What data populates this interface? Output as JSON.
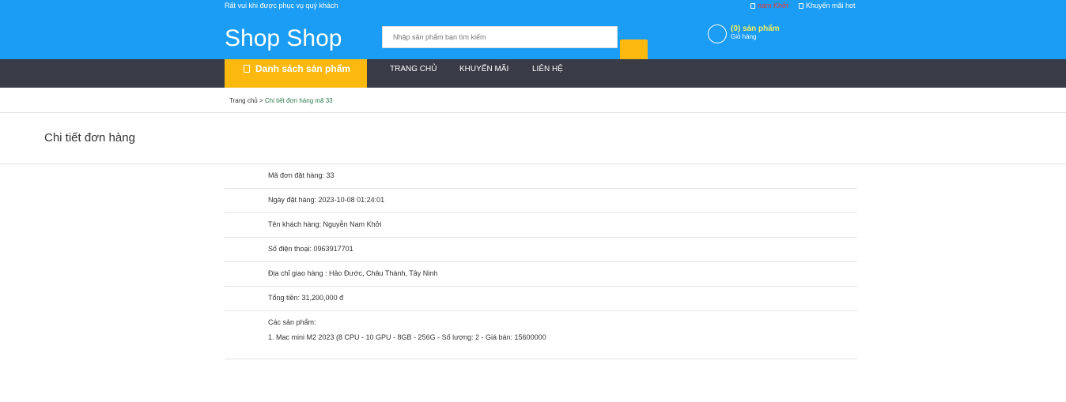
{
  "topbar": {
    "welcome": "Rất vui khi được phục vụ quý khách",
    "user_link": "nam Khởi",
    "promo_link": "Khuyến mãi hot"
  },
  "header": {
    "logo": "Shop Shop",
    "search_placeholder": "Nhập sản phẩm bạn tìm kiếm",
    "cart_count": "(0) sản phẩm",
    "cart_label": "Giỏ hàng"
  },
  "nav": {
    "categories": "Danh sách sản phẩm",
    "items": [
      "TRANG CHỦ",
      "KHUYẾN MÃI",
      "LIÊN HỆ"
    ]
  },
  "breadcrumb": {
    "home": "Trang chủ",
    "separator": ">",
    "current": "Chi tiết đơn hàng mã 33"
  },
  "page_title": "Chi tiết đơn hàng",
  "order": {
    "id": "Mã đơn đặt hàng: 33",
    "date": "Ngày đặt hàng: 2023-10-08 01:24:01",
    "customer": "Tên khách hàng: Nguyễn Nam Khởi",
    "phone": "Số điện thoại: 0963917701",
    "address": "Địa chỉ giao hàng : Hảo Đước, Châu Thành, Tây Ninh",
    "total": "Tổng tiền: 31,200,000 đ",
    "products_label": "Các sản phẩm:",
    "products": [
      "1. Mac mini M2 2023 (8 CPU - 10 GPU - 8GB - 256G - Số lượng: 2 - Giá bán: 15600000"
    ]
  },
  "colors": {
    "header_blue": "#1b9cf5",
    "accent_yellow": "#fbb80e",
    "nav_dark": "#393b47",
    "user_link_red": "#e8372f"
  }
}
